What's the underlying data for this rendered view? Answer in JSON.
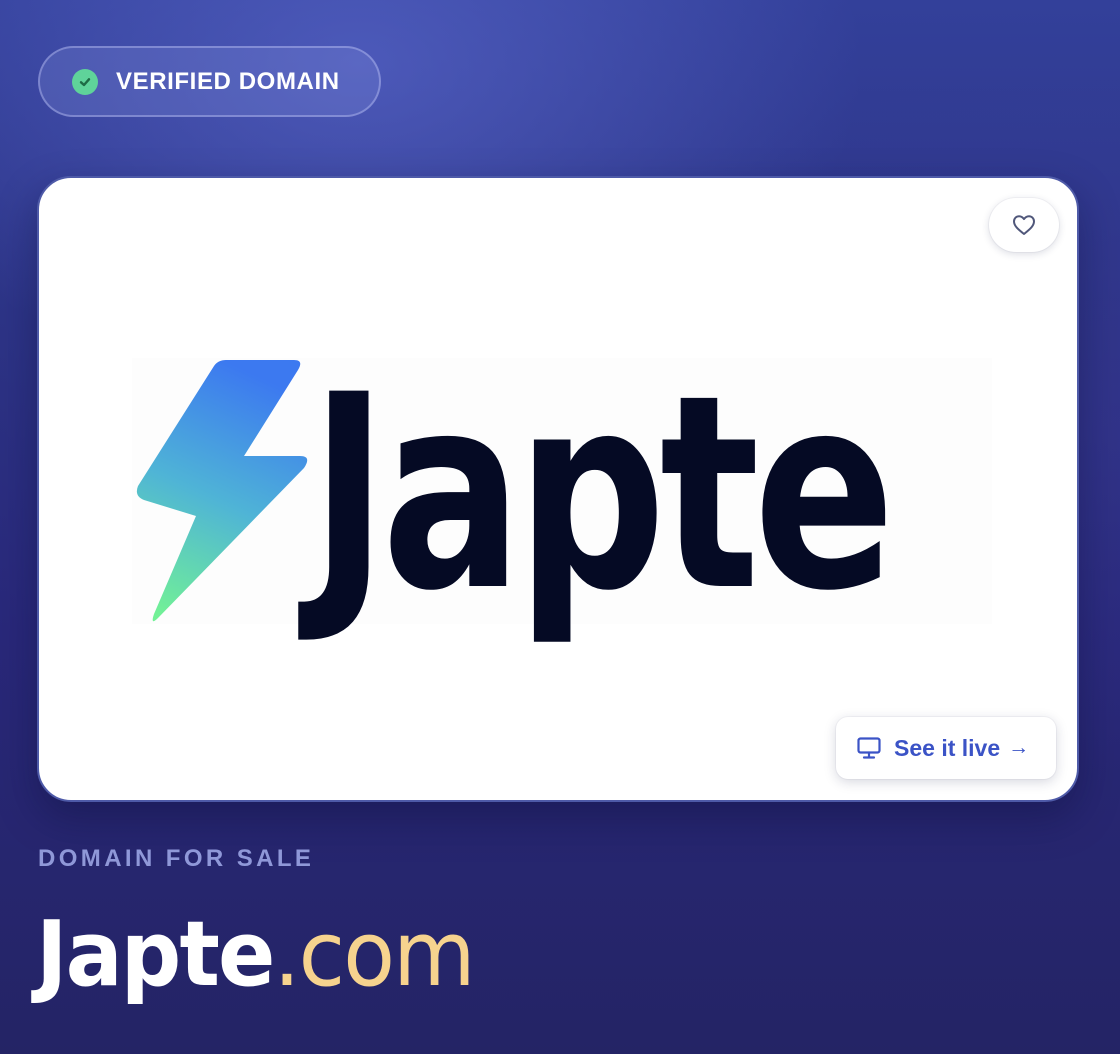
{
  "badge": {
    "label": "VERIFIED DOMAIN",
    "icon": "check-circle-icon",
    "icon_color": "#5fd39a"
  },
  "preview": {
    "logo_text": "Japte",
    "logo_icon": "lightning-bolt-icon",
    "logo_gradient": [
      "#3f7cf2",
      "#6df09a"
    ],
    "favorite_icon": "heart-icon",
    "see_live": {
      "label": "See it live",
      "icon": "monitor-icon",
      "arrow": "→"
    }
  },
  "listing": {
    "section_label": "DOMAIN FOR SALE",
    "domain_base": "Japte",
    "domain_tld": ".com"
  },
  "colors": {
    "accent": "#3b53c6",
    "tld": "#f6d38e",
    "section_label": "#8f98d8"
  }
}
